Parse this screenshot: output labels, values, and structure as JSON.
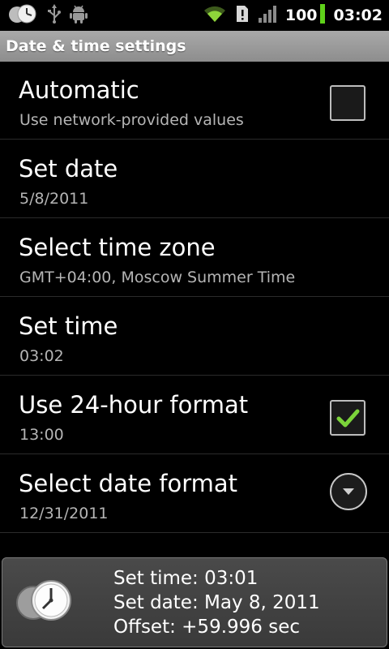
{
  "status_bar": {
    "battery_level": "100",
    "time": "03:02",
    "left_icons": [
      "clock-notification-icon",
      "usb-icon",
      "android-debug-icon"
    ],
    "right_icons": [
      "wifi-icon",
      "alert-icon",
      "signal-icon",
      "battery-icon"
    ]
  },
  "title_bar": {
    "title": "Date & time settings"
  },
  "settings": {
    "items": [
      {
        "title": "Automatic",
        "summary": "Use network-provided values",
        "widget": "checkbox",
        "checked": false
      },
      {
        "title": "Set date",
        "summary": "5/8/2011"
      },
      {
        "title": "Select time zone",
        "summary": "GMT+04:00, Moscow Summer Time"
      },
      {
        "title": "Set time",
        "summary": "03:02"
      },
      {
        "title": "Use 24-hour format",
        "summary": "13:00",
        "widget": "checkbox",
        "checked": true
      },
      {
        "title": "Select date format",
        "summary": "12/31/2011",
        "widget": "dropdown"
      }
    ]
  },
  "toast": {
    "line1": "Set time: 03:01",
    "line2": "Set date: May 8, 2011",
    "line3": "Offset: +59.996 sec",
    "icon": "clock-sync-icon"
  },
  "colors": {
    "background": "#000000",
    "title_bar": "#9a9a9a",
    "summary_text": "#b5b5b5",
    "check_green": "#7bd33a",
    "wifi_green": "#8ed43a",
    "battery_green": "#5fd11a"
  }
}
